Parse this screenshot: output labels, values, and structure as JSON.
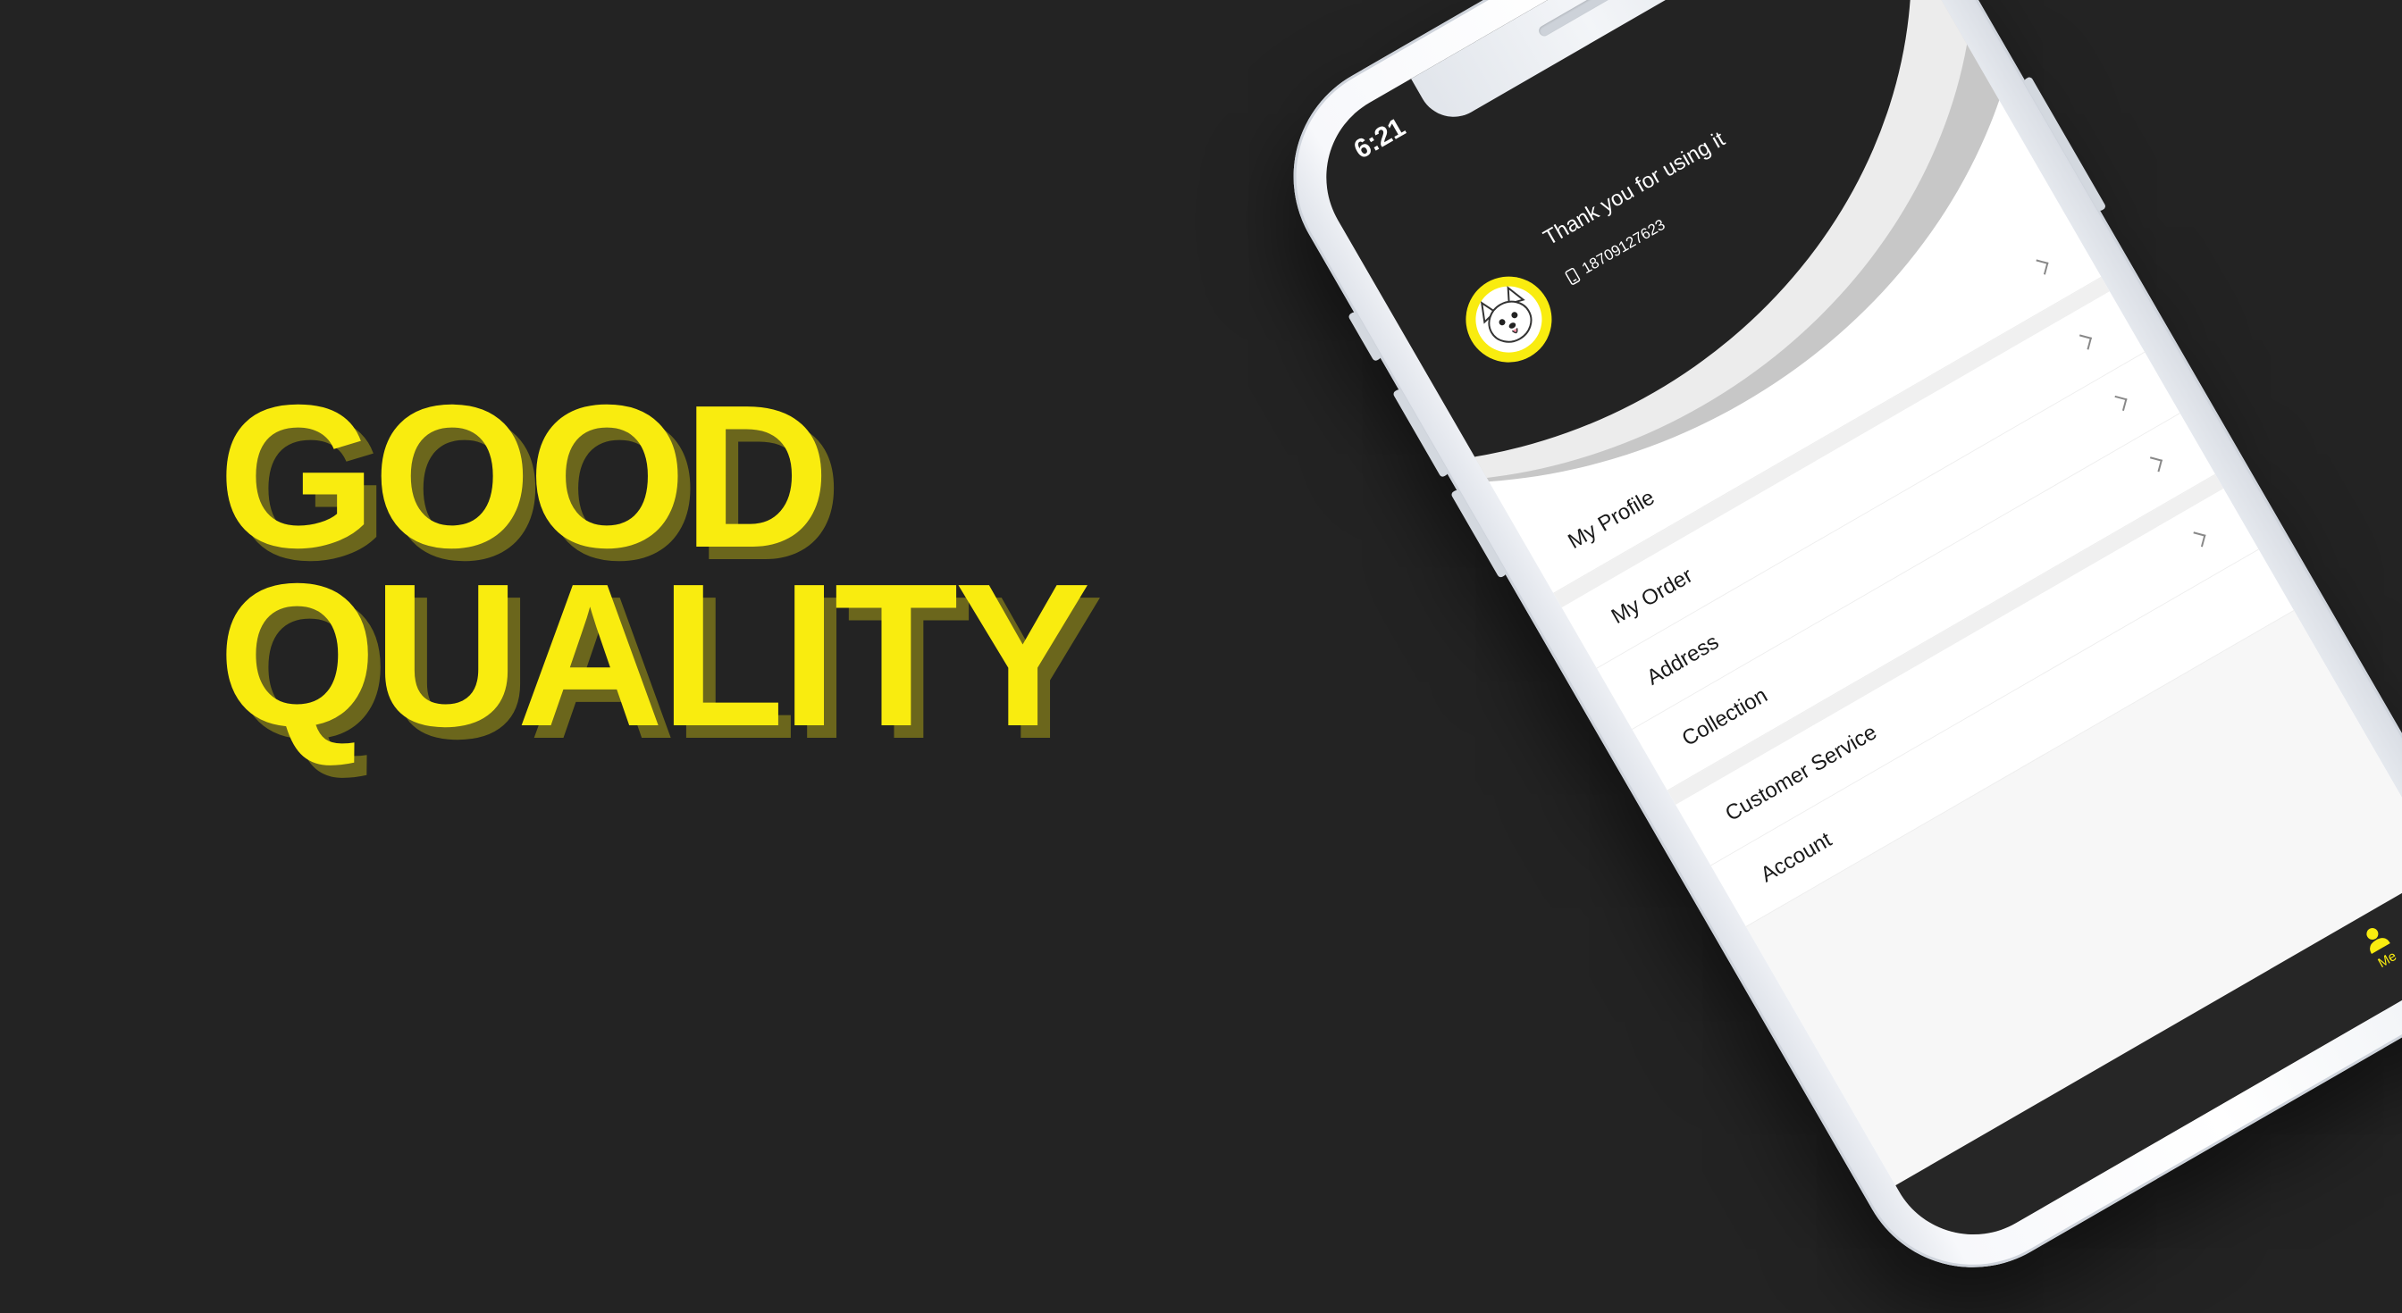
{
  "headline": {
    "line1": "GOOD",
    "line2": "QUALITY"
  },
  "colors": {
    "background": "#232323",
    "accent": "#f9ec0f",
    "accent_shadow": "#6b661c",
    "header_dark": "#232323"
  },
  "status_bar": {
    "time": "6:21",
    "icons": [
      "signal-dots-icon",
      "wifi-icon",
      "battery-icon"
    ]
  },
  "header": {
    "greeting": "Thank you for using it",
    "phone_number": "18709127623",
    "avatar": "dog-avatar-icon",
    "message_icon": "chat-bubble-icon"
  },
  "menu": {
    "items": [
      {
        "label": "My Profile"
      },
      {
        "label": "My Order"
      },
      {
        "label": "Address"
      },
      {
        "label": "Collection"
      },
      {
        "label": "Customer Service"
      },
      {
        "label": "Account"
      }
    ]
  },
  "tab_bar": {
    "active_tab": "Me",
    "active_icon": "person-icon"
  }
}
